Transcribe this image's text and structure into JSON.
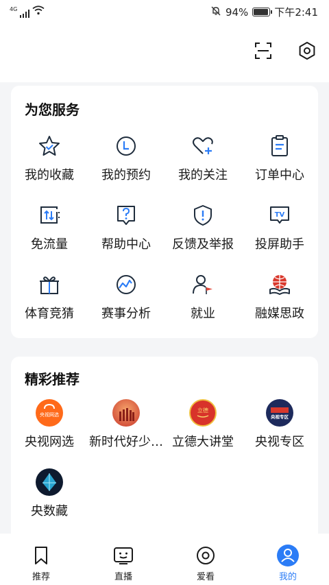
{
  "status_bar": {
    "network": "4G",
    "battery": "94%",
    "battery_level": 0.94,
    "time": "下午2:41"
  },
  "header": {
    "scan_icon": "scan-icon",
    "settings_icon": "gear-icon"
  },
  "services": {
    "title": "为您服务",
    "items": [
      {
        "label": "我的收藏",
        "icon": "star-icon"
      },
      {
        "label": "我的预约",
        "icon": "clock-icon"
      },
      {
        "label": "我的关注",
        "icon": "heart-plus-icon"
      },
      {
        "label": "订单中心",
        "icon": "clipboard-icon"
      },
      {
        "label": "免流量",
        "icon": "data-free-icon"
      },
      {
        "label": "帮助中心",
        "icon": "help-icon"
      },
      {
        "label": "反馈及举报",
        "icon": "report-shield-icon"
      },
      {
        "label": "投屏助手",
        "icon": "tv-cast-icon"
      },
      {
        "label": "体育竞猜",
        "icon": "gift-icon"
      },
      {
        "label": "赛事分析",
        "icon": "analysis-icon"
      },
      {
        "label": "就业",
        "icon": "employment-icon"
      },
      {
        "label": "融媒思政",
        "icon": "globe-book-icon"
      }
    ]
  },
  "recommend": {
    "title": "精彩推荐",
    "items": [
      {
        "label": "央视网选",
        "icon": "cctv-shop-logo",
        "logo_text": "央视网选"
      },
      {
        "label": "新时代好少…",
        "icon": "new-era-youth-logo",
        "logo_text": ""
      },
      {
        "label": "立德大讲堂",
        "icon": "lide-lecture-logo",
        "logo_text": "立德"
      },
      {
        "label": "央视专区",
        "icon": "cctv-zone-logo",
        "logo_text": "央视专区"
      },
      {
        "label": "央数藏",
        "icon": "digital-collection-logo",
        "logo_text": ""
      }
    ]
  },
  "tabs": [
    {
      "label": "推荐",
      "icon": "bookmark-icon",
      "active": false
    },
    {
      "label": "直播",
      "icon": "tv-face-icon",
      "active": false
    },
    {
      "label": "爱看",
      "icon": "circle-dot-icon",
      "active": false
    },
    {
      "label": "我的",
      "icon": "user-icon",
      "active": true
    }
  ],
  "colors": {
    "accent": "#2b7cf6",
    "background": "#f4f5f7",
    "card": "#ffffff",
    "icon_stroke": "#1f2d3d"
  }
}
